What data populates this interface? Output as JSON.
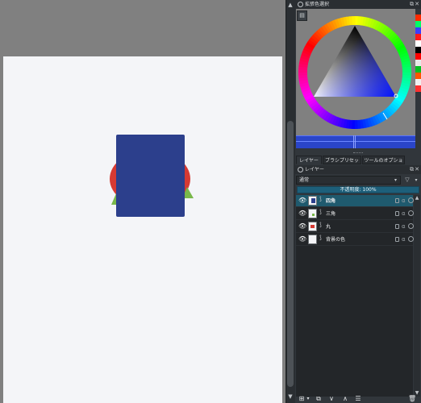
{
  "color_docker": {
    "title": "拡張色選択",
    "float": "⧉",
    "close": "✕",
    "swatches": [
      "#ff2a00",
      "#00ff66",
      "#3a3fff",
      "#ff1a1a",
      "#ffffff",
      "#000000",
      "#ff0000",
      "#e8e8e8",
      "#00c020",
      "#ff5500",
      "#f0f0f0",
      "#ff3030"
    ],
    "current_color": "#2a45c9"
  },
  "tabs": [
    {
      "label": "レイヤー"
    },
    {
      "label": "ブラシプリセット"
    },
    {
      "label": "ツールのオプション"
    }
  ],
  "layers_docker": {
    "title": "レイヤー",
    "float": "⧉",
    "close": "✕",
    "blend_mode": "通常",
    "opacity_label": "不透明度: 100%",
    "layers": [
      {
        "name": "四角",
        "selected": true
      },
      {
        "name": "三角",
        "selected": false
      },
      {
        "name": "丸",
        "selected": false
      },
      {
        "name": "背景の色",
        "selected": false
      }
    ]
  },
  "canvas": {
    "paper_color": "#f4f5f8",
    "square_color": "#2c3f8c",
    "circle_color": "#d63a33",
    "triangle_color": "#79b84a"
  }
}
